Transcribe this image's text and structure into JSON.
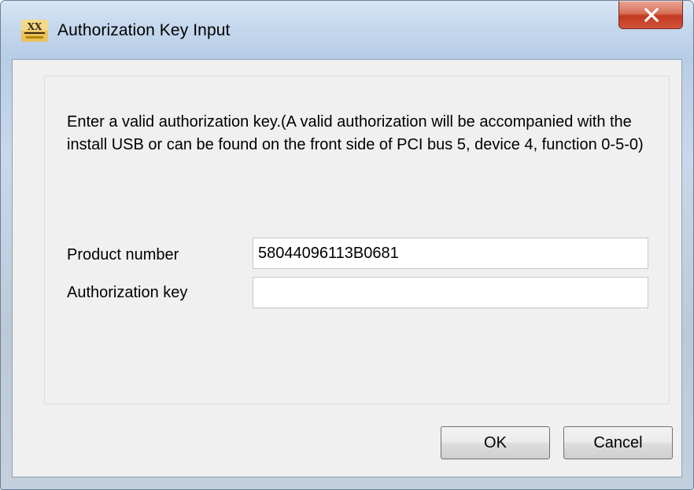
{
  "window": {
    "title": "Authorization Key Input",
    "app_icon": "xx-app-icon",
    "close_icon": "close-x-icon"
  },
  "dialog": {
    "message": "Enter a valid authorization key.(A valid authorization will be accompanied with the install USB or can be found on the front side of PCI bus 5, device 4, function 0-5-0)",
    "product_number": {
      "label": "Product number",
      "value": "58044096113B0681"
    },
    "authorization_key": {
      "label": "Authorization key",
      "value": ""
    }
  },
  "buttons": {
    "ok": "OK",
    "cancel": "Cancel"
  },
  "colors": {
    "close_button": "#c8452b",
    "dialog_background": "#f0f0f0"
  }
}
